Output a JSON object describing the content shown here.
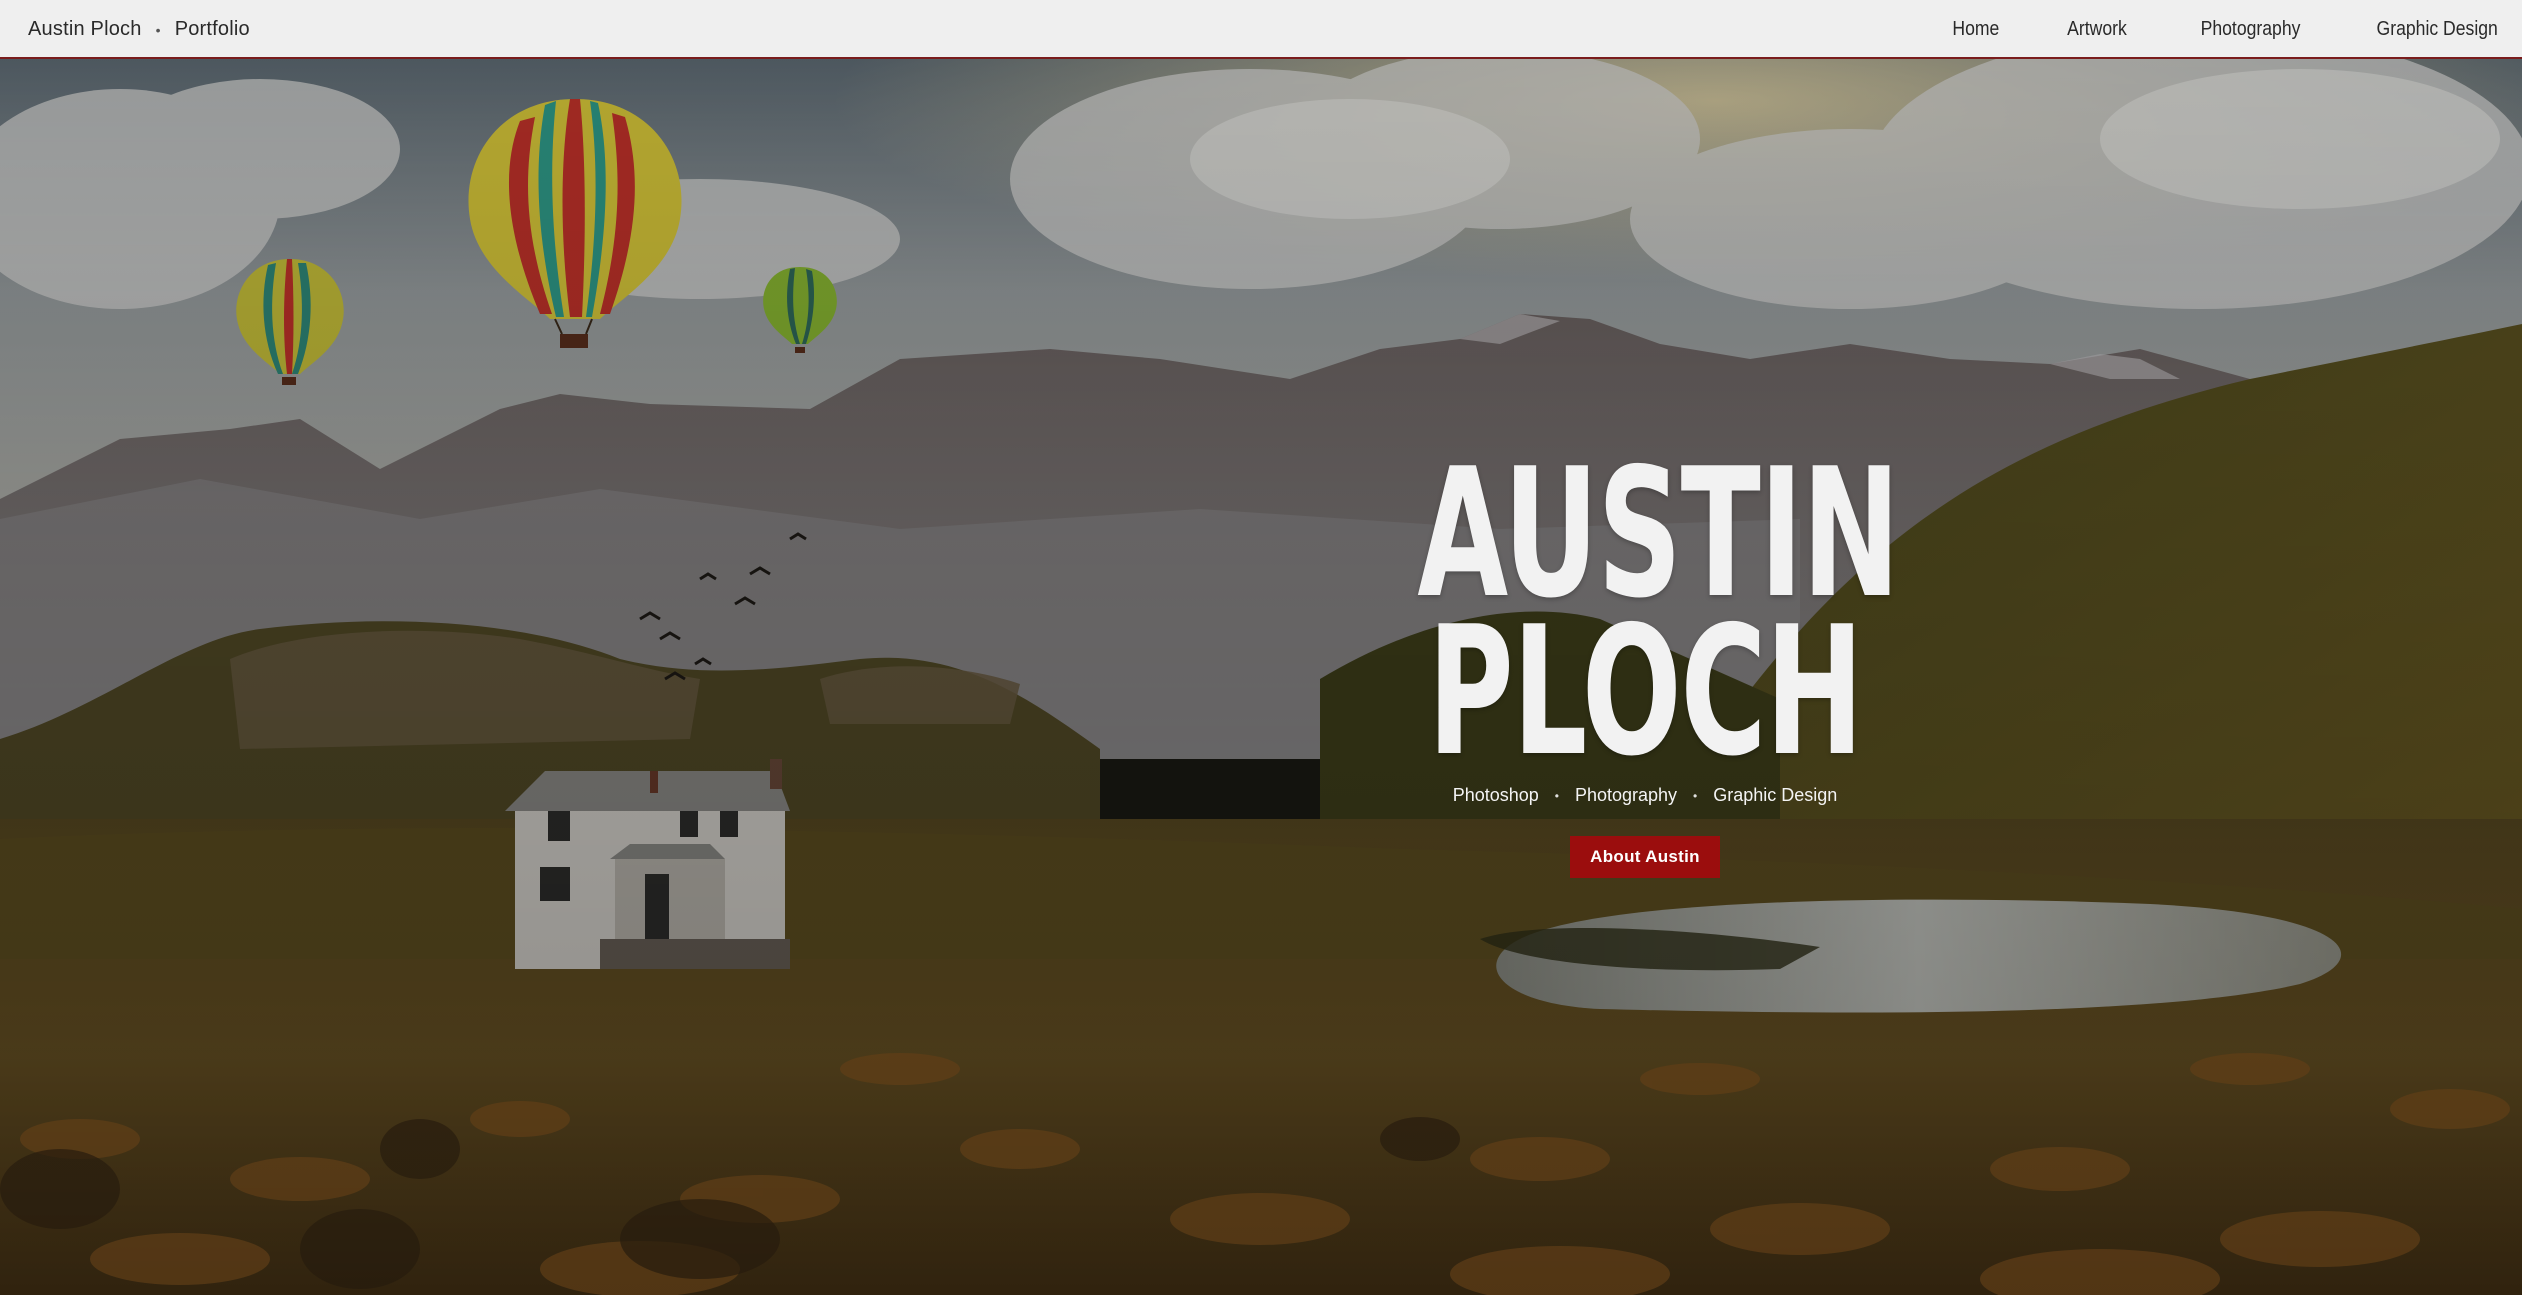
{
  "header": {
    "brand_name": "Austin Ploch",
    "brand_separator": "•",
    "brand_section": "Portfolio",
    "nav": [
      "Home",
      "Artwork",
      "Photography",
      "Graphic Design"
    ]
  },
  "hero": {
    "title_line1": "AUSTIN",
    "title_line2": "PLOCH",
    "tags": [
      "Photoshop",
      "Photography",
      "Graphic Design"
    ],
    "tag_separator": "•",
    "button_label": "About Austin"
  },
  "colors": {
    "accent": "#9b0d0d",
    "nav_background": "#efefef",
    "nav_border": "#7a1c1c"
  }
}
